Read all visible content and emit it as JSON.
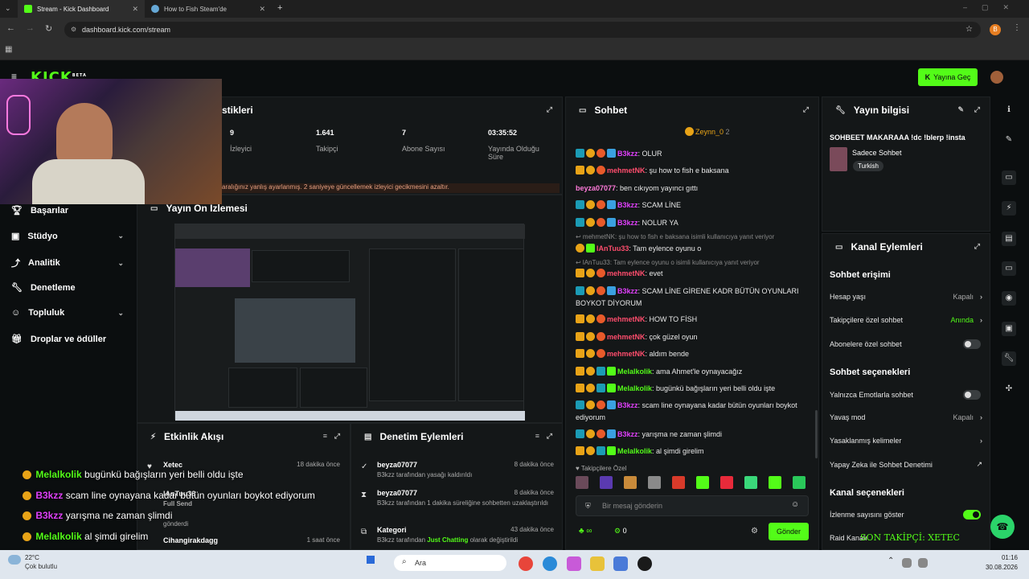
{
  "browser": {
    "tabs": [
      {
        "label": "Stream - Kick Dashboard",
        "active": true
      },
      {
        "label": "How to Fish Steam'de",
        "active": false
      }
    ],
    "url": "dashboard.kick.com/stream",
    "profile_initial": "B"
  },
  "header": {
    "logo": "KICK",
    "logo_badge": "BETA",
    "go_live": "Yayına Geç"
  },
  "sidebar": {
    "items": [
      {
        "label": "Başarılar"
      },
      {
        "label": "Stüdyo"
      },
      {
        "label": "Analitik"
      },
      {
        "label": "Denetleme"
      },
      {
        "label": "Topluluk"
      },
      {
        "label": "Droplar ve ödüller"
      }
    ]
  },
  "stats": {
    "title": "stikleri",
    "items": [
      {
        "value": "9",
        "label": "İzleyici"
      },
      {
        "value": "1.641",
        "label": "Takipçi"
      },
      {
        "value": "7",
        "label": "Abone Sayısı"
      },
      {
        "value": "03:35:52",
        "label": "Yayında Olduğu Süre"
      }
    ],
    "warning": "aralığınız yanlış ayarlanmış. 2 saniyeye güncellemek izleyici gecikmesini azaltır."
  },
  "preview": {
    "title": "Yayın Ön İzlemesi"
  },
  "activity": {
    "title": "Etkinlik Akışı",
    "rows": [
      {
        "name": "Xetec",
        "time": "18 dakika önce",
        "sub": ""
      },
      {
        "name": "lAnTuu33",
        "time": "",
        "sub": "Full Send"
      },
      {
        "name": "",
        "time": "",
        "sub": "gönderdi"
      },
      {
        "name": "Cihangirakdagg",
        "time": "1 saat önce",
        "sub": ""
      }
    ]
  },
  "moderation": {
    "title": "Denetim Eylemleri",
    "rows": [
      {
        "name": "beyza07077",
        "time": "8 dakika önce",
        "sub": "B3kzz tarafından yasağı kaldırıldı"
      },
      {
        "name": "beyza07077",
        "time": "8 dakika önce",
        "sub": "B3kzz tarafından 1 dakika süreliğine sohbetten uzaklaştırıldı"
      },
      {
        "name": "Kategori",
        "time": "43 dakika önce",
        "sub_prefix": "B3kzz tarafından ",
        "sub_green": "Just Chatting",
        "sub_suffix": " olarak değiştirildi"
      }
    ]
  },
  "chat": {
    "title": "Sohbet",
    "pinned_user": "Zeynn_0",
    "pinned_count": "2",
    "messages": [
      {
        "user": "B3kzz",
        "color": "#e040fb",
        "text": "OLUR"
      },
      {
        "user": "mehmetNK",
        "color": "#ff4d6d",
        "text": "şu how to fish e baksana"
      },
      {
        "user": "beyza07077",
        "color": "#ff7ad9",
        "text": "ben cıkıyom yayıncı gıttı"
      },
      {
        "user": "B3kzz",
        "color": "#e040fb",
        "text": "SCAM LİNE"
      },
      {
        "user": "B3kzz",
        "color": "#e040fb",
        "text": "NOLUR YA"
      },
      {
        "reply": "mehmetNK: şu how to fish e baksana isimli kullanıcıya yanıt veriyor"
      },
      {
        "user": "lAnTuu33",
        "color": "#ff4d6d",
        "text": "Tam eylence oyunu o"
      },
      {
        "reply": "lAnTuu33: Tam eylence oyunu o isimli kullanıcıya yanıt veriyor"
      },
      {
        "user": "mehmetNK",
        "color": "#ff4d6d",
        "text": "evet"
      },
      {
        "user": "B3kzz",
        "color": "#e040fb",
        "text": "SCAM LİNE GİRENE KADR BÜTÜN OYUNLARI BOYKOT DİYORUM"
      },
      {
        "user": "mehmetNK",
        "color": "#ff4d6d",
        "text": "HOW TO FİSH"
      },
      {
        "user": "mehmetNK",
        "color": "#ff4d6d",
        "text": "çok güzel oyun"
      },
      {
        "user": "mehmetNK",
        "color": "#ff4d6d",
        "text": "aldım bende"
      },
      {
        "user": "Melalkolik",
        "color": "#53fc18",
        "text": "ama Ahmet'le oynayacağız"
      },
      {
        "user": "Melalkolik",
        "color": "#53fc18",
        "text": "bugünkü bağışların yeri belli oldu işte"
      },
      {
        "user": "B3kzz",
        "color": "#e040fb",
        "text": "scam line oynayana kadar bütün oyunları boykot ediyorum"
      },
      {
        "user": "B3kzz",
        "color": "#e040fb",
        "text": "yarışma ne zaman şlimdi"
      },
      {
        "user": "Melalkolik",
        "color": "#53fc18",
        "text": "al şimdi girelim"
      }
    ],
    "followers_only": "Takipçilere Özel",
    "input_placeholder": "Bir mesaj gönderin",
    "counter": "0",
    "send_label": "Gönder"
  },
  "stream_info": {
    "title": "Yayın bilgisi",
    "stream_title": "SOHBEET MAKARAAA !dc !blerp !insta",
    "category": "Sadece Sohbet",
    "tag": "Turkish"
  },
  "channel_actions": {
    "title": "Kanal Eylemleri",
    "chat_access": "Sohbet erişimi",
    "rows_access": [
      {
        "label": "Hesap yaşı",
        "value": "Kapalı",
        "type": "link"
      },
      {
        "label": "Takipçilere özel sohbet",
        "value": "Anında",
        "type": "link-green"
      },
      {
        "label": "Abonelere özel sohbet",
        "value": "",
        "type": "toggle-off"
      }
    ],
    "chat_options": "Sohbet seçenekleri",
    "rows_options": [
      {
        "label": "Yalnızca Emotlarla sohbet",
        "value": "",
        "type": "toggle-off"
      },
      {
        "label": "Yavaş mod",
        "value": "Kapalı",
        "type": "link"
      },
      {
        "label": "Yasaklanmış kelimeler",
        "value": "",
        "type": "link"
      },
      {
        "label": "Yapay Zeka ile Sohbet Denetimi",
        "value": "",
        "type": "external"
      }
    ],
    "channel_options": "Kanal seçenekleri",
    "rows_channel": [
      {
        "label": "İzlenme sayısını göster",
        "value": "",
        "type": "toggle-on"
      },
      {
        "label": "Raid Kanalı",
        "value": "",
        "type": "plain"
      }
    ]
  },
  "overlay": {
    "lines": [
      {
        "user": "Melalkolik",
        "color": "#53fc18",
        "text": "bugünkü bağışların yeri belli oldu işte"
      },
      {
        "user": "B3kzz",
        "color": "#e040fb",
        "text": "scam line oynayana kadar bütün oyunları boykot ediyorum"
      },
      {
        "user": "B3kzz",
        "color": "#e040fb",
        "text": "yarışma ne zaman şlimdi"
      },
      {
        "user": "Melalkolik",
        "color": "#53fc18",
        "text": "al şimdi girelim"
      }
    ],
    "last_follower": "SON TAKİPÇİ: XETEC"
  },
  "taskbar": {
    "weather_temp": "22°C",
    "weather_desc": "Çok bulutlu",
    "search": "Ara",
    "time": "01:16",
    "date": "30.08.2026"
  }
}
